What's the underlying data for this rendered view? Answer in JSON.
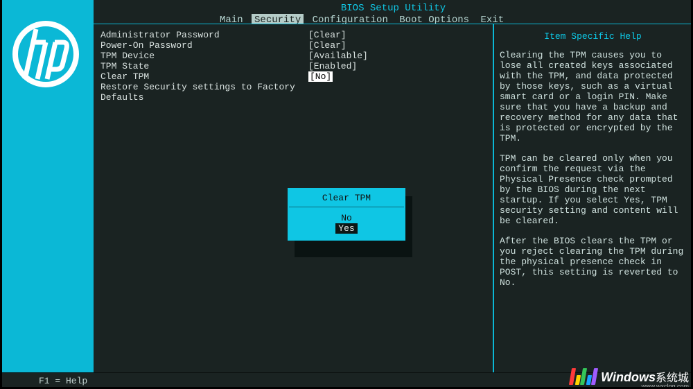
{
  "title": "BIOS Setup Utility",
  "menu": {
    "items": [
      "Main",
      "Security",
      "Configuration",
      "Boot Options",
      "Exit"
    ],
    "active_index": 1
  },
  "settings": [
    {
      "label": "Administrator Password",
      "value": "[Clear]"
    },
    {
      "label": "Power-On Password",
      "value": "[Clear]"
    },
    {
      "label": "TPM Device",
      "value": "[Available]"
    },
    {
      "label": "TPM State",
      "value": "[Enabled]"
    },
    {
      "label": "Clear TPM",
      "value": "[No]",
      "selected": true
    },
    {
      "label": "Restore Security settings to Factory Defaults",
      "value": ""
    }
  ],
  "dialog": {
    "title": "Clear TPM",
    "options": [
      "No",
      "Yes"
    ],
    "selected_index": 1
  },
  "help": {
    "title": "Item Specific Help",
    "paragraphs": [
      "Clearing the TPM causes you to lose all created keys associated with the TPM, and data protected by those keys, such as a virtual smart card or a login PIN. Make sure that you have a backup and recovery method for any data that is protected or encrypted by the TPM.",
      "TPM can be cleared only when you confirm the request via the Physical Presence check prompted by the BIOS during the next startup. If you select Yes, TPM security setting and content will be cleared.",
      "After the BIOS clears the TPM or you reject clearing the TPM during the physical presence check in POST, this setting is reverted to No."
    ]
  },
  "footer": "F1 = Help",
  "watermark": {
    "brand": "Windows",
    "suffix": "系统城",
    "url": "www.wxclgg.com",
    "bar_colors": [
      "#ff3a3a",
      "#ffd400",
      "#34c759",
      "#1aa4ff",
      "#a05cff"
    ]
  },
  "logo": "hp"
}
